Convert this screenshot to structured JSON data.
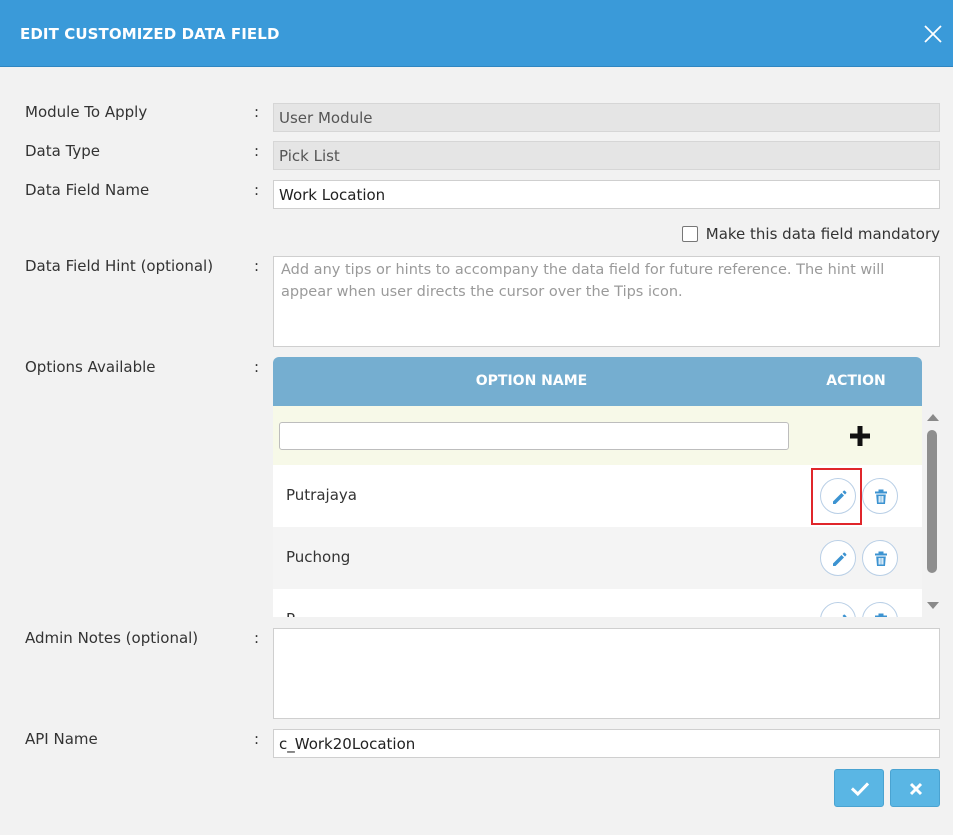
{
  "dialog": {
    "title": "EDIT CUSTOMIZED DATA FIELD"
  },
  "icons": {
    "close": "close-icon",
    "add": "plus-icon",
    "edit": "pencil-icon",
    "delete": "trash-icon",
    "confirm": "check-icon",
    "cancel": "x-icon"
  },
  "colors": {
    "header": "#3a9ad9",
    "table_header": "#75aed0",
    "button": "#5ab6e4",
    "highlight": "#e0262b"
  },
  "form": {
    "colon": ":",
    "module": {
      "label": "Module To Apply",
      "value": "User Module"
    },
    "data_type": {
      "label": "Data Type",
      "value": "Pick List"
    },
    "field_name": {
      "label": "Data Field Name",
      "value": "Work Location"
    },
    "mandatory": {
      "label": "Make this data field mandatory",
      "checked": false
    },
    "hint": {
      "label": "Data Field Hint (optional)",
      "placeholder": "Add any tips or hints to accompany the data field for future reference. The hint will appear when user directs the cursor over the Tips icon."
    },
    "options": {
      "label": "Options Available",
      "columns": [
        "OPTION NAME",
        "ACTION"
      ],
      "new_value": "",
      "rows": [
        "Putrajaya",
        "Puchong",
        "P"
      ]
    },
    "admin_notes": {
      "label": "Admin Notes (optional)",
      "value": ""
    },
    "api_name": {
      "label": "API Name",
      "value": "c_Work20Location"
    }
  }
}
